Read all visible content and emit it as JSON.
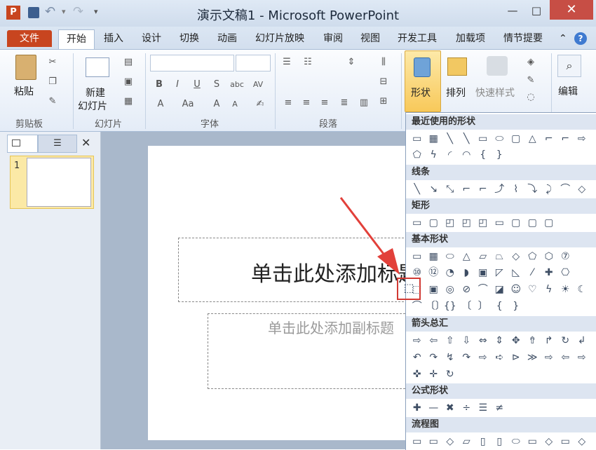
{
  "window": {
    "title": "演示文稿1 - Microsoft PowerPoint",
    "minimize": "—",
    "maximize": "□",
    "close": "✕"
  },
  "qat": {
    "app_icon": "P",
    "save": "💾",
    "undo": "↶",
    "redo": "↷",
    "more": "▾"
  },
  "tabs": {
    "file": "文件",
    "items": [
      "开始",
      "插入",
      "设计",
      "切换",
      "动画",
      "幻灯片放映",
      "审阅",
      "视图",
      "开发工具",
      "加载项",
      "情节提要"
    ],
    "collapse": "⌃",
    "help": "?"
  },
  "ribbon": {
    "paste": "粘贴",
    "new_slide": [
      "新建",
      "幻灯片"
    ],
    "shapes": "形状",
    "arrange": "排列",
    "quick_styles": "快速样式",
    "editing": "编辑",
    "groups": [
      "剪贴板",
      "幻灯片",
      "字体",
      "段落"
    ],
    "font_buttons": [
      "B",
      "I",
      "U",
      "S",
      "abc",
      "AV",
      "A",
      "Aa",
      "A",
      "A"
    ]
  },
  "slides_panel": {
    "thumb_number": "1",
    "close": "✕"
  },
  "slide": {
    "title_placeholder": "单击此处添加标题",
    "subtitle_placeholder": "单击此处添加副标题"
  },
  "gallery": {
    "sections": [
      "最近使用的形状",
      "线条",
      "矩形",
      "基本形状",
      "箭头总汇",
      "公式形状",
      "流程图"
    ],
    "recent": [
      [
        "▭",
        "▦",
        "╲",
        "╲",
        "▭",
        "⬭",
        "▢",
        "△",
        "⌐",
        "⌐",
        "⇨"
      ],
      [
        "⬠",
        "ϟ",
        "◜",
        "◠",
        "{",
        "}"
      ]
    ],
    "lines": [
      [
        "╲",
        "↘",
        "⤡",
        "⌐",
        "⌐",
        "⤴",
        "⌇",
        "⤵",
        "⤸",
        "⌒",
        "◇"
      ]
    ],
    "rectangles": [
      [
        "▭",
        "▢",
        "◰",
        "◰",
        "◰",
        "▭",
        "▢",
        "▢",
        "▢"
      ]
    ],
    "basic": [
      [
        "▭",
        "▦",
        "⬭",
        "△",
        "▱",
        "⏢",
        "◇",
        "⬠",
        "⬡",
        "⑦"
      ],
      [
        "⑩",
        "⑫",
        "◔",
        "◗",
        "▣",
        "◸",
        "◺",
        "⁄",
        "✚",
        "⎔"
      ],
      [
        "⬚",
        "▣",
        "◎",
        "⊘",
        "⌒",
        "◪",
        "☺",
        "♡",
        "ϟ",
        "☀",
        "☾"
      ],
      [
        "⌒",
        "〔〕",
        "{}",
        "〔",
        "〕",
        "{",
        "}"
      ]
    ],
    "arrows": [
      [
        "⇨",
        "⇦",
        "⇧",
        "⇩",
        "⇔",
        "⇕",
        "✥",
        "⇮",
        "↱",
        "↻",
        "↲"
      ],
      [
        "↶",
        "↷",
        "↯",
        "↷",
        "⇨",
        "➪",
        "⊳",
        "≫",
        "⇨",
        "⇦",
        "⇨"
      ],
      [
        "✜",
        "✛",
        "↻"
      ]
    ],
    "equation": [
      [
        "✚",
        "—",
        "✖",
        "÷",
        "☰",
        "≠"
      ]
    ],
    "flowchart": [
      [
        "▭",
        "▭",
        "◇",
        "▱",
        "▯",
        "▯",
        "⬭",
        "▭",
        "◇",
        "▭",
        "◇"
      ]
    ]
  },
  "colors": {
    "file_tab": "#c8451f",
    "highlight": "#d23a34",
    "shapes_active": "#f8c95a"
  }
}
